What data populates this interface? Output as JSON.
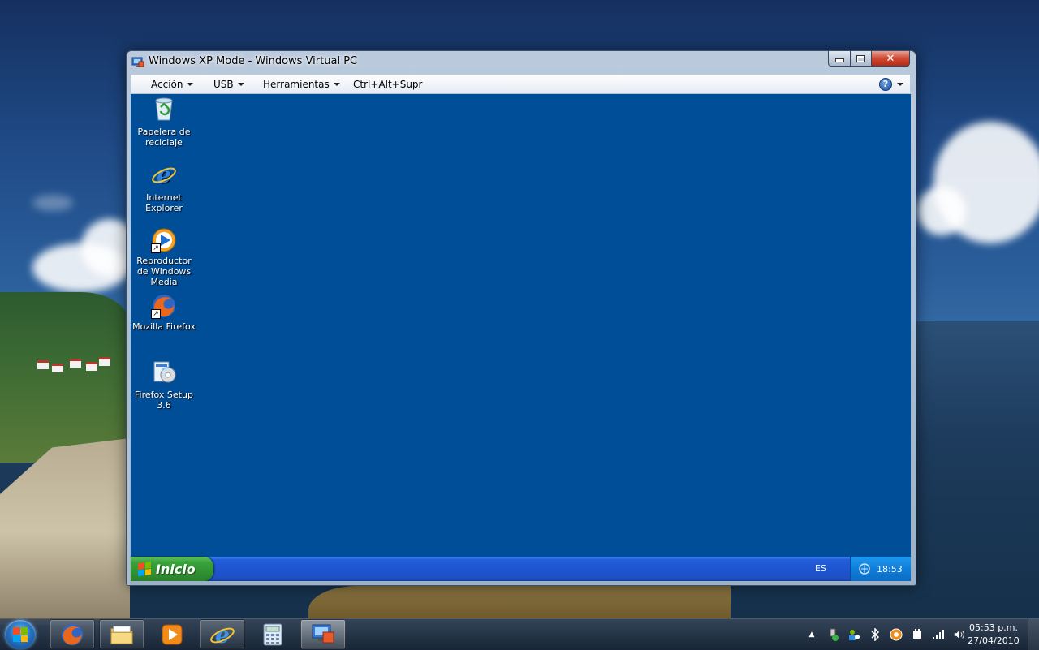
{
  "window": {
    "title": "Windows XP Mode - Windows Virtual PC",
    "menu": [
      "Acción",
      "USB",
      "Herramientas",
      "Ctrl+Alt+Supr"
    ],
    "help_icon": "help-icon"
  },
  "guest": {
    "desktop_icons": [
      {
        "label": "Papelera de reciclaje",
        "icon": "recycle-bin-icon"
      },
      {
        "label": "Internet Explorer",
        "icon": "internet-explorer-icon"
      },
      {
        "label": "Reproductor de Windows Media",
        "icon": "windows-media-player-icon"
      },
      {
        "label": "Mozilla Firefox",
        "icon": "firefox-icon"
      },
      {
        "label": "Firefox Setup 3.6",
        "icon": "setup-installer-icon"
      }
    ],
    "taskbar": {
      "start_label": "Inicio",
      "language": "ES",
      "clock": "18:53"
    }
  },
  "host": {
    "pinned": [
      "start-orb",
      "firefox-icon",
      "explorer-folder-icon",
      "media-player-icon",
      "internet-explorer-icon",
      "calculator-icon",
      "virtual-pc-icon"
    ],
    "clock_time": "05:53 p.m.",
    "clock_date": "27/04/2010"
  },
  "colors": {
    "xp_desktop": "#004e98",
    "xp_taskbar": "#245edb",
    "xp_start": "#38a13a"
  }
}
